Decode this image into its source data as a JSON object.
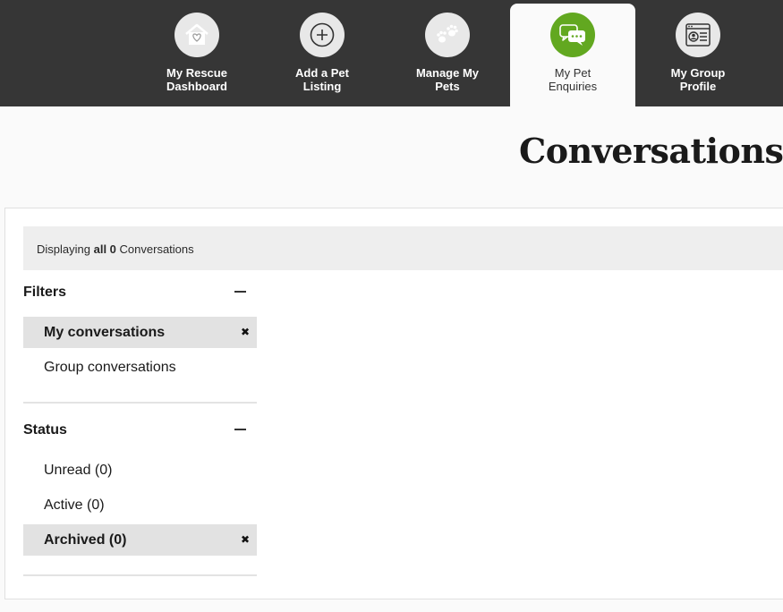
{
  "nav": {
    "items": [
      {
        "label": "My Rescue\nDashboard",
        "icon": "house-heart-icon",
        "active": false
      },
      {
        "label": "Add a Pet\nListing",
        "icon": "plus-circle-icon",
        "active": false
      },
      {
        "label": "Manage My\nPets",
        "icon": "paw-print-icon",
        "active": false
      },
      {
        "label": "My Pet\nEnquiries",
        "icon": "chat-bubbles-icon",
        "active": true
      },
      {
        "label": "My Group\nProfile",
        "icon": "profile-card-icon",
        "active": false
      }
    ]
  },
  "page": {
    "title": "Conversations"
  },
  "summary": {
    "prefix": "Displaying",
    "count_text": "all 0",
    "suffix": "Conversations"
  },
  "filters": {
    "title": "Filters",
    "items": [
      {
        "label": "My conversations",
        "selected": true
      },
      {
        "label": "Group conversations",
        "selected": false
      }
    ]
  },
  "status": {
    "title": "Status",
    "items": [
      {
        "label": "Unread (0)",
        "selected": false
      },
      {
        "label": "Active (0)",
        "selected": false
      },
      {
        "label": "Archived (0)",
        "selected": true
      }
    ]
  },
  "colors": {
    "nav_bg": "#363636",
    "accent": "#62a820",
    "selected_bg": "#e2e2e2"
  }
}
